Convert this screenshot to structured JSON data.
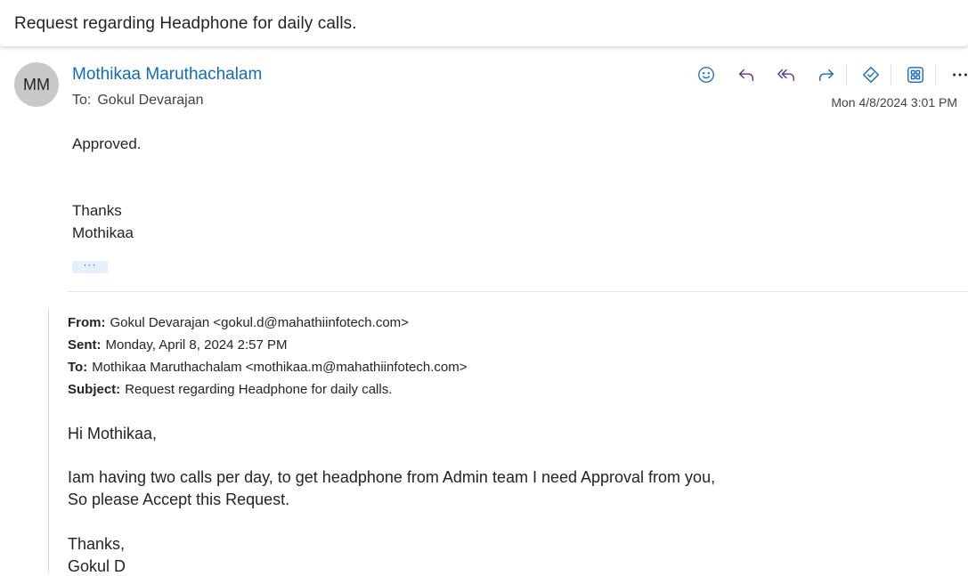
{
  "subject": "Request regarding Headphone for daily calls.",
  "sender": {
    "initials": "MM",
    "name": "Mothikaa Maruthachalam",
    "to_label": "To:",
    "to": "Gokul Devarajan",
    "timestamp": "Mon 4/8/2024 3:01 PM",
    "avatar_color": "#c8c8c8",
    "name_color": "#0f6cbd"
  },
  "actions": {
    "icons": [
      "smiley-icon",
      "reply-icon",
      "reply-all-icon",
      "forward-icon",
      "approvals-icon",
      "apps-icon",
      "more-icon"
    ],
    "accent_color": "#0f6cbd",
    "purple_color": "#5c2e91"
  },
  "reply_body": {
    "line1": "Approved.",
    "line2": "Thanks",
    "line3": "Mothikaa",
    "ellipsis": "···"
  },
  "quoted": {
    "from_label": "From:",
    "from_value": "Gokul Devarajan <gokul.d@mahathiinfotech.com>",
    "sent_label": "Sent:",
    "sent_value": "Monday, April 8, 2024 2:57 PM",
    "to_label": "To:",
    "to_value": "Mothikaa Maruthachalam <mothikaa.m@mahathiinfotech.com>",
    "subject_label": "Subject:",
    "subject_value": "Request regarding Headphone for daily calls.",
    "greeting": "Hi Mothikaa,",
    "para1": "Iam having two calls per day, to get headphone from Admin team I need Approval from you,",
    "para2": "So please Accept this Request.",
    "closing1": "Thanks,",
    "closing2": "Gokul D"
  }
}
